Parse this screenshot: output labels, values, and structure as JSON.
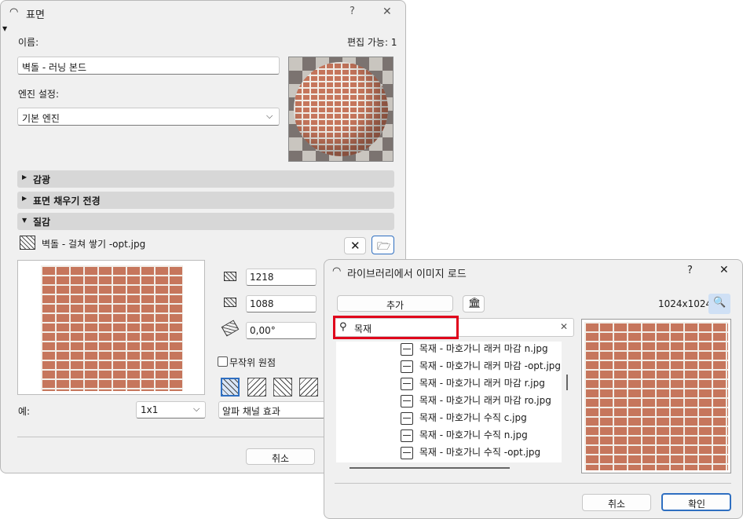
{
  "surface_dialog": {
    "title": "표면",
    "help": "?",
    "close": "✕",
    "name_label": "이름:",
    "edit_count": "편집 가능: 1",
    "name_value": "벽돌 - 러닝 본드",
    "engine_label": "엔진 설정:",
    "engine_value": "기본 엔진",
    "sections": [
      {
        "label": "감광",
        "expanded": false
      },
      {
        "label": "표면 채우기 전경",
        "expanded": false
      },
      {
        "label": "질감",
        "expanded": true
      }
    ],
    "texture_name": "벽돌 - 걸쳐 쌓기 -opt.jpg",
    "width_value": "1218",
    "height_value": "1088",
    "angle_value": "0,00°",
    "random_origin_label": "무작위 원점",
    "example_label": "예:",
    "example_value": "1x1",
    "alpha_label": "알파 채널 효과",
    "cancel": "취소"
  },
  "library_dialog": {
    "title": "라이브러리에서 이미지 로드",
    "help": "?",
    "close": "✕",
    "add_button": "추가",
    "resolution": "1024x1024",
    "search_value": "목재",
    "clear": "✕",
    "items": [
      "목재 - 마호가니 래커 마감 n.jpg",
      "목재 - 마호가니 래커 마감 -opt.jpg",
      "목재 - 마호가니 래커 마감 r.jpg",
      "목재 - 마호가니 래커 마감 ro.jpg",
      "목재 - 마호가니 수직 c.jpg",
      "목재 - 마호가니 수직 n.jpg",
      "목재 - 마호가니 수직 -opt.jpg"
    ],
    "cancel": "취소",
    "ok": "확인"
  },
  "colors": {
    "highlight": "#e0001b",
    "accent": "#2f6fc1"
  }
}
